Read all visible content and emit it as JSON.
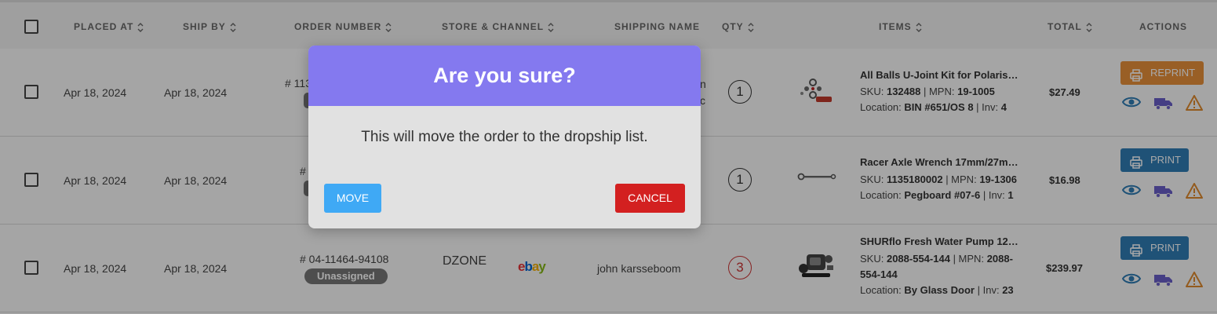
{
  "header": {
    "placed_at": "PLACED AT",
    "ship_by": "SHIP BY",
    "order_number": "ORDER NUMBER",
    "store_channel": "STORE & CHANNEL",
    "shipping_name": "SHIPPING NAME",
    "qty": "QTY",
    "items": "ITEMS",
    "total": "TOTAL",
    "actions": "ACTIONS"
  },
  "rows": [
    {
      "placed": "Apr 18, 2024",
      "ship_by": "Apr 18, 2024",
      "order_partial": "# 113",
      "ship_partial_1": "n",
      "ship_partial_2": "c",
      "qty": "1",
      "item_title": "All Balls U-Joint Kit for Polaris…",
      "sku_label": "SKU:",
      "sku": "132488",
      "mpn_label": "| MPN:",
      "mpn": "19-1005",
      "loc_label": "Location:",
      "location": "BIN #651/OS 8",
      "inv_label": "| Inv:",
      "inv": "4",
      "total": "$27.49",
      "print_label": "REPRINT"
    },
    {
      "placed": "Apr 18, 2024",
      "ship_by": "Apr 18, 2024",
      "order_partial": "#",
      "qty": "1",
      "item_title": "Racer Axle Wrench 17mm/27m…",
      "sku_label": "SKU:",
      "sku": "1135180002",
      "mpn_label": "| MPN:",
      "mpn": "19-1306",
      "loc_label": "Location:",
      "location": "Pegboard #07-6",
      "inv_label": "| Inv:",
      "inv": "1",
      "total": "$16.98",
      "print_label": "PRINT"
    },
    {
      "placed": "Apr 18, 2024",
      "ship_by": "Apr 18, 2024",
      "order_number": "# 04-11464-94108",
      "badge": "Unassigned",
      "store": "DZONE",
      "shipping_name": "john karsseboom",
      "qty": "3",
      "item_title": "SHURflo Fresh Water Pump 12…",
      "sku_label": "SKU:",
      "sku": "2088-554-144",
      "mpn_label": "| MPN:",
      "mpn_1": "2088-",
      "mpn_2": "554-144",
      "loc_label": "Location:",
      "location": "By Glass Door",
      "inv_label": "| Inv:",
      "inv": "23",
      "total": "$239.97",
      "print_label": "PRINT"
    }
  ],
  "channel_logo": {
    "e": "e",
    "b": "b",
    "a": "a",
    "y": "y"
  },
  "modal": {
    "title": "Are you sure?",
    "message": "This will move the order to the dropship list.",
    "move_label": "MOVE",
    "cancel_label": "CANCEL"
  },
  "colors": {
    "modal_header": "#8479ef",
    "move_button": "#3fa9f5",
    "cancel_button": "#d32020",
    "print_button": "#2f7db5",
    "reprint_button": "#e8913a"
  }
}
